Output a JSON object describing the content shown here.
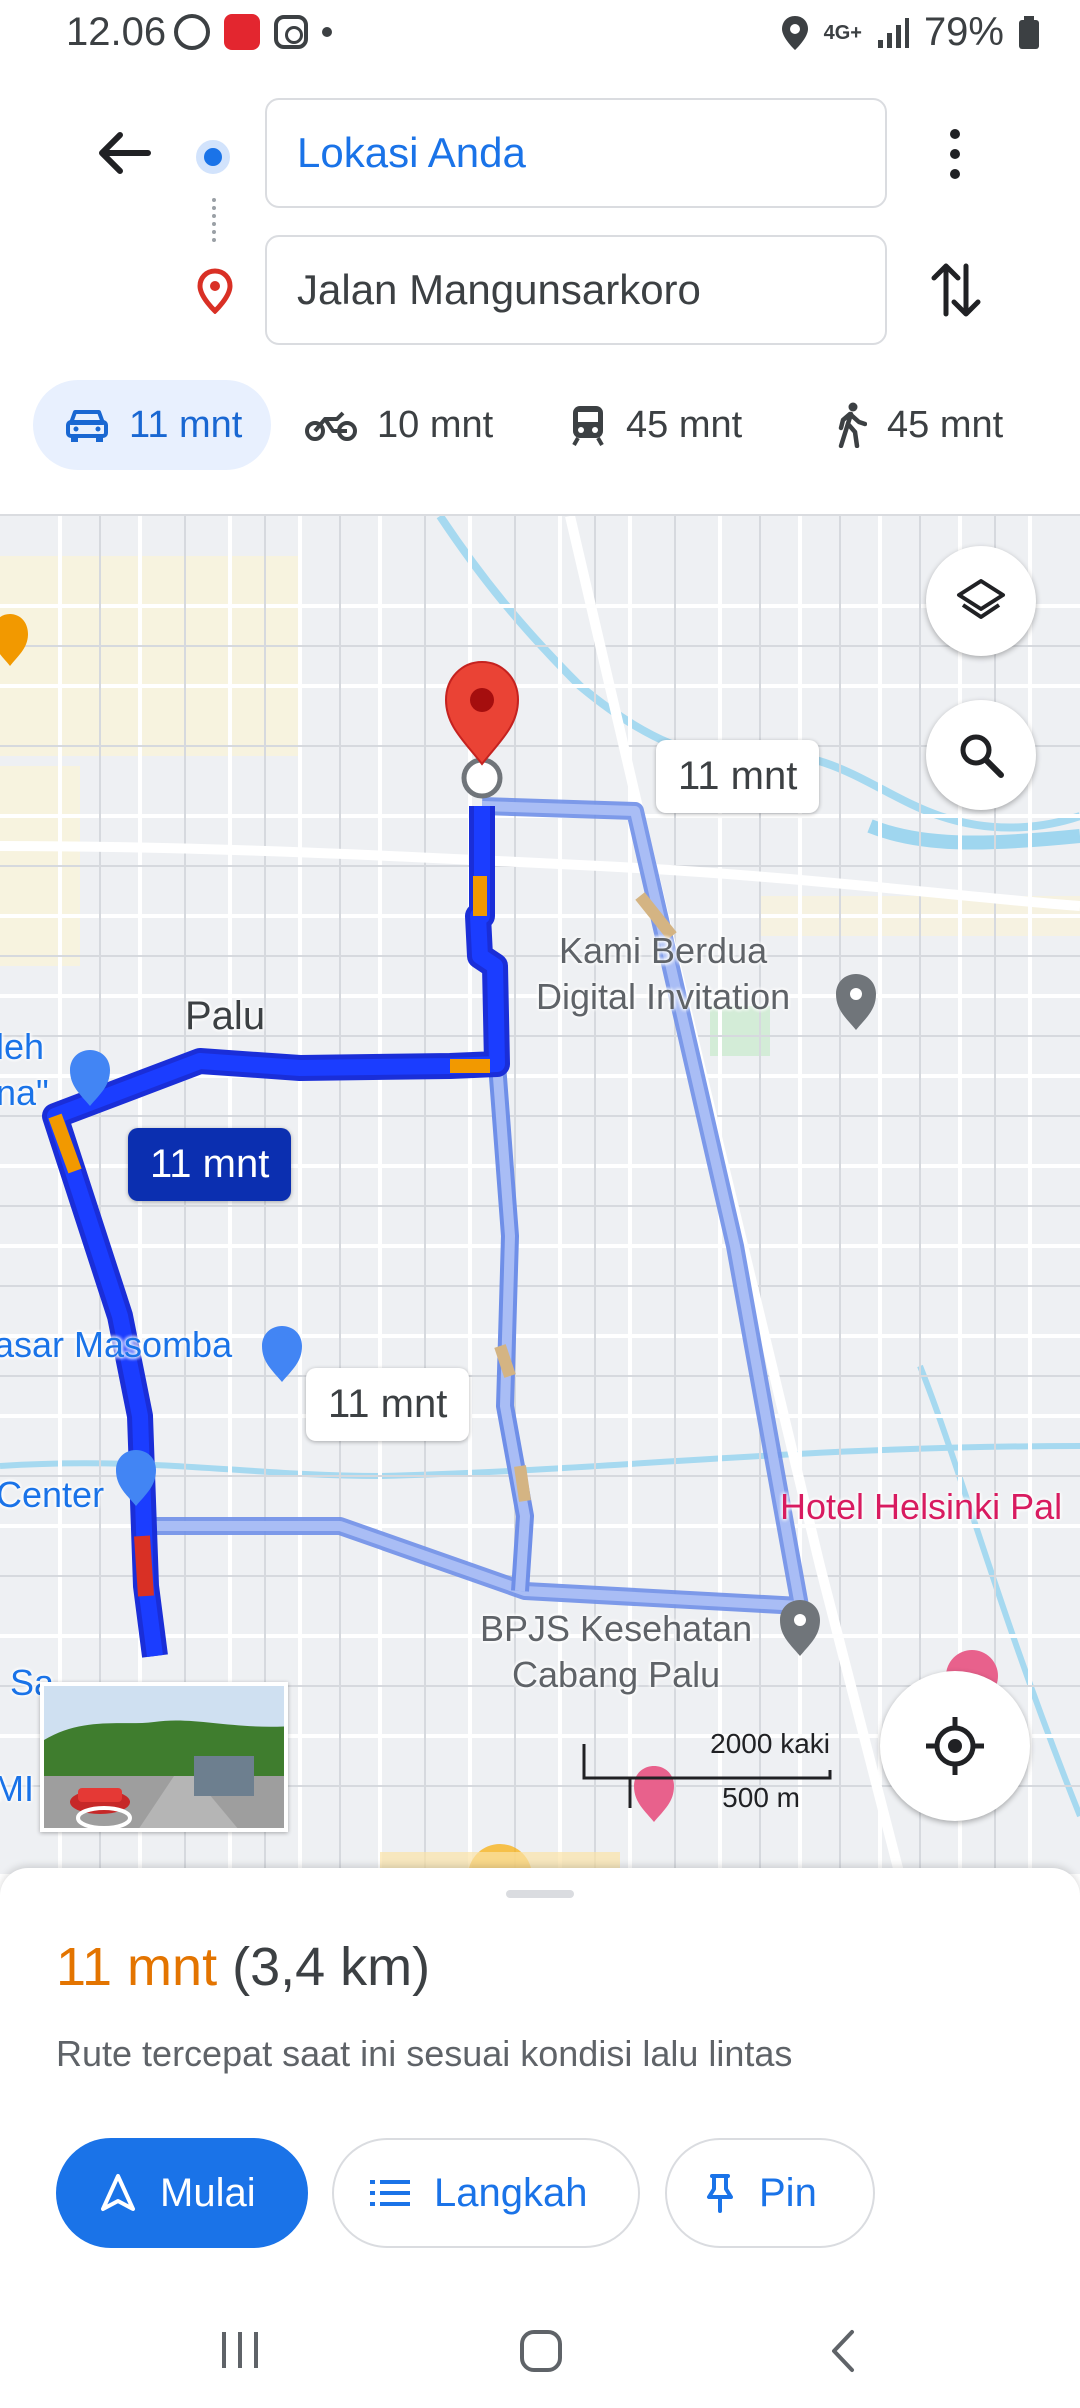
{
  "status_bar": {
    "time": "12.06",
    "network": "4G+",
    "battery": "79%"
  },
  "directions": {
    "origin": "Lokasi Anda",
    "destination": "Jalan Mangunsarkoro"
  },
  "modes": [
    {
      "name": "car",
      "time": "11 mnt",
      "selected": true
    },
    {
      "name": "motorcycle",
      "time": "10 mnt"
    },
    {
      "name": "transit",
      "time": "45 mnt"
    },
    {
      "name": "walk",
      "time": "45 mnt"
    }
  ],
  "map": {
    "labels": {
      "palu": "Palu",
      "kami_line1": "Kami Berdua",
      "kami_line2": "Digital Invitation",
      "hotel": "Hotel Helsinki Pal",
      "bpjs_line1": "BPJS Kesehatan",
      "bpjs_line2": "Cabang Palu",
      "pasar": "asar Masomba",
      "center": "Center",
      "oleh_line1": "leh",
      "oleh_line2": "na\"",
      "sa": "Sa",
      "mi": "MI"
    },
    "route_labels": {
      "top": "11 mnt",
      "main": "11 mnt",
      "middle": "11 mnt"
    },
    "scale": {
      "feet": "2000 kaki",
      "meters": "500 m"
    }
  },
  "sheet": {
    "time": "11 mnt",
    "distance": "(3,4 km)",
    "subtitle": "Rute tercepat saat ini sesuai kondisi lalu lintas",
    "start_label": "Mulai",
    "steps_label": "Langkah",
    "pin_label": "Pin"
  },
  "colors": {
    "accent": "#1a73e8",
    "route_primary": "#1a3cf0",
    "route_alt": "#8ea9f0",
    "time_orange": "#e37400",
    "pin_red": "#ea4335"
  }
}
